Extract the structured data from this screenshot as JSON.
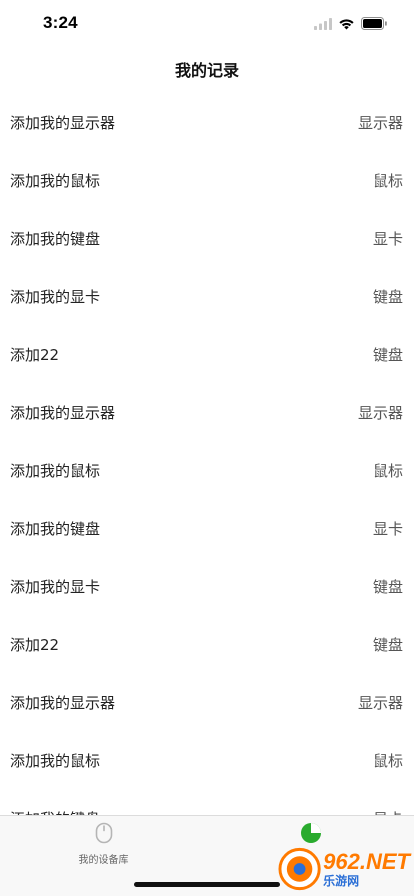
{
  "status_bar": {
    "time": "3:24",
    "icons": [
      "signal-icon",
      "wifi-icon",
      "battery-icon"
    ]
  },
  "nav": {
    "title": "我的记录"
  },
  "records": [
    {
      "title": "添加我的显示器",
      "type": "显示器"
    },
    {
      "title": "添加我的鼠标",
      "type": "鼠标"
    },
    {
      "title": "添加我的键盘",
      "type": "显卡"
    },
    {
      "title": "添加我的显卡",
      "type": "键盘"
    },
    {
      "title": "添加22",
      "type": "键盘"
    },
    {
      "title": "添加我的显示器",
      "type": "显示器"
    },
    {
      "title": "添加我的鼠标",
      "type": "鼠标"
    },
    {
      "title": "添加我的键盘",
      "type": "显卡"
    },
    {
      "title": "添加我的显卡",
      "type": "键盘"
    },
    {
      "title": "添加22",
      "type": "键盘"
    },
    {
      "title": "添加我的显示器",
      "type": "显示器"
    },
    {
      "title": "添加我的鼠标",
      "type": "鼠标"
    },
    {
      "title": "添加我的键盘",
      "type": "显卡"
    }
  ],
  "tab_bar": {
    "tabs": [
      {
        "label": "我的设备库",
        "icon": "mouse-icon",
        "active": false
      },
      {
        "label": "",
        "icon": "pie-chart-icon",
        "active": true
      }
    ]
  },
  "colors": {
    "active_tab": "#2aab2e",
    "inactive_tab": "#b5b5b5",
    "watermark_orange": "#ff7a00",
    "watermark_blue": "#2b6fd6"
  },
  "watermark": {
    "main": "962.NET",
    "sub": "乐游网"
  }
}
